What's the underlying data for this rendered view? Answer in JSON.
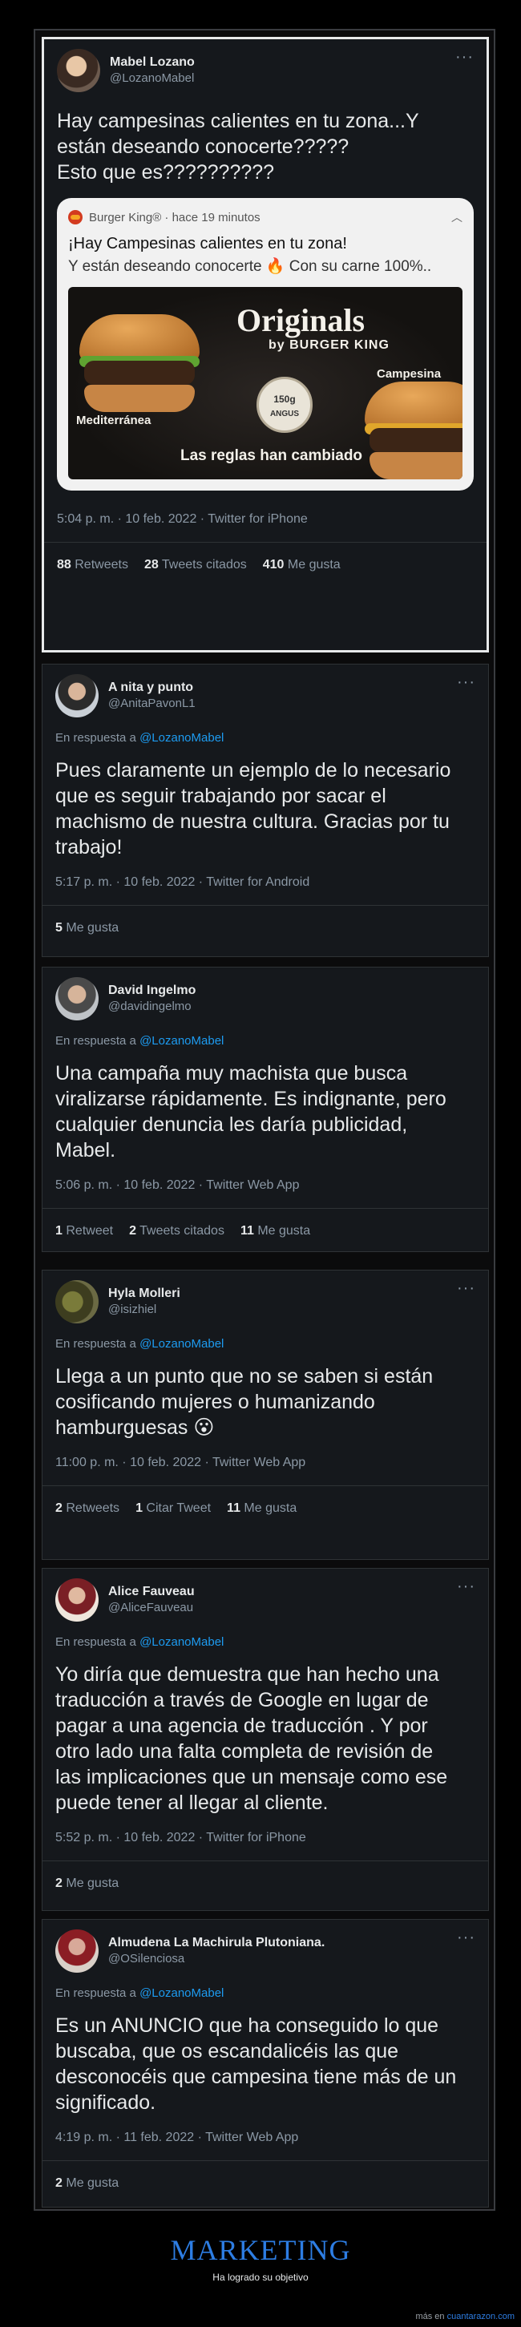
{
  "tweets": [
    {
      "name": "Mabel Lozano",
      "handle": "@LozanoMabel",
      "text": "Hay campesinas calientes en tu zona...Y\nestán deseando conocerte?????\nEsto que es??????????",
      "notification": {
        "app": "Burger King® · hace 19 minutos",
        "title": "¡Hay Campesinas calientes en tu zona!",
        "text": "Y están deseando conocerte 🔥 Con su carne 100%..",
        "ad_title": "Originals",
        "ad_brand": "by BURGER KING",
        "ad_left": "Mediterránea",
        "ad_right": "Campesina",
        "ad_slogan": "Las reglas han cambiado",
        "badge_top": "150g",
        "badge_bottom": "ANGUS"
      },
      "meta": "5:04 p. m. · 10 feb. 2022 · Twitter for iPhone",
      "stats": [
        {
          "n": "88",
          "label": "Retweets"
        },
        {
          "n": "28",
          "label": "Tweets citados"
        },
        {
          "n": "410",
          "label": "Me gusta"
        }
      ]
    },
    {
      "name": "A nita y punto",
      "handle": "@AnitaPavonL1",
      "reply_prefix": "En respuesta a",
      "reply_to": "@LozanoMabel",
      "text": "Pues claramente un ejemplo de lo  necesario\nque es seguir trabajando por sacar el\nmachismo de nuestra cultura. Gracias por tu\ntrabajo!",
      "meta": "5:17 p. m. · 10 feb. 2022 · Twitter for Android",
      "stats": [
        {
          "n": "5",
          "label": "Me gusta"
        }
      ]
    },
    {
      "name": "David Ingelmo",
      "handle": "@davidingelmo",
      "reply_prefix": "En respuesta a",
      "reply_to": "@LozanoMabel",
      "text": "Una campaña muy machista que busca\nviralizarse rápidamente. Es indignante, pero\ncualquier denuncia les daría publicidad,\nMabel.",
      "meta": "5:06 p. m. · 10 feb. 2022 · Twitter Web App",
      "stats": [
        {
          "n": "1",
          "label": "Retweet"
        },
        {
          "n": "2",
          "label": "Tweets citados"
        },
        {
          "n": "11",
          "label": "Me gusta"
        }
      ]
    },
    {
      "name": "Hyla Molleri",
      "handle": "@isizhiel",
      "reply_prefix": "En respuesta a",
      "reply_to": "@LozanoMabel",
      "text": "Llega a un punto que no se saben si están\ncosificando mujeres o humanizando\nhamburguesas 😮",
      "meta": "11:00 p. m. · 10 feb. 2022 · Twitter Web App",
      "stats": [
        {
          "n": "2",
          "label": "Retweets"
        },
        {
          "n": "1",
          "label": "Citar Tweet"
        },
        {
          "n": "11",
          "label": "Me gusta"
        }
      ]
    },
    {
      "name": "Alice Fauveau",
      "handle": "@AliceFauveau",
      "reply_prefix": "En respuesta a",
      "reply_to": "@LozanoMabel",
      "text": "Yo diría que demuestra que han hecho una\ntraducción a través de Google en lugar de\npagar a una agencia de traducción . Y por\notro lado una falta completa de revisión de\nlas implicaciones que un mensaje como ese\npuede tener al llegar al cliente.",
      "meta": "5:52 p. m. · 10 feb. 2022 · Twitter for iPhone",
      "stats": [
        {
          "n": "2",
          "label": "Me gusta"
        }
      ]
    },
    {
      "name": "Almudena La Machirula Plutoniana.",
      "handle": "@OSilenciosa",
      "reply_prefix": "En respuesta a",
      "reply_to": "@LozanoMabel",
      "text": "Es un ANUNCIO que ha conseguido lo que\nbuscaba, que os escandalicéis las que\ndesconocéis que campesina tiene más de un\nsignificado.",
      "meta": "4:19 p. m. · 11 feb. 2022 · Twitter Web App",
      "stats": [
        {
          "n": "2",
          "label": "Me gusta"
        }
      ]
    }
  ],
  "more_glyph": "···",
  "footer": {
    "title": "MARKETING",
    "subtitle": "Ha logrado su objetivo",
    "credit_prefix": "más en",
    "credit_link": "cuantarazon.com"
  },
  "colors": {
    "background": "#000000",
    "card": "#15181c",
    "link": "#1d9bf0",
    "muted": "#8b98a5",
    "footer_title": "#2d7de3"
  }
}
